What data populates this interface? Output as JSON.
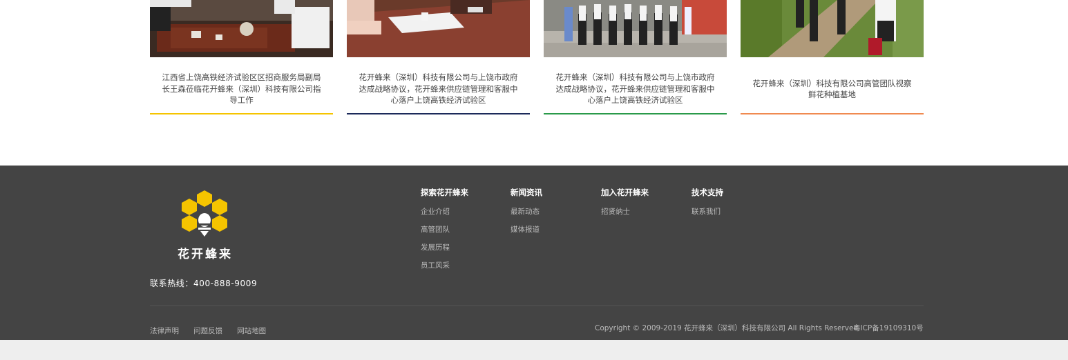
{
  "news": [
    {
      "title": "江西省上饶高铁经济试验区区招商服务局副局长王森莅临花开蜂来（深圳）科技有限公司指导工作",
      "accent": "#f5c400"
    },
    {
      "title": "花开蜂来（深圳）科技有限公司与上饶市政府达成战略协议，花开蜂来供应链管理和客服中心落户上饶高铁经济试验区",
      "accent": "#1c2a5a"
    },
    {
      "title": "花开蜂来（深圳）科技有限公司与上饶市政府达成战略协议，花开蜂来供应链管理和客服中心落户上饶高铁经济试验区",
      "accent": "#2a9a4a"
    },
    {
      "title": "花开蜂来（深圳）科技有限公司高管团队视察鲜花种植基地",
      "accent": "#f08a50"
    }
  ],
  "footer": {
    "logo_text": "花开蜂来",
    "hotline": "联系热线：400-888-9009",
    "columns": [
      {
        "heading": "探索花开蜂来",
        "links": [
          "企业介绍",
          "高管团队",
          "发展历程",
          "员工风采"
        ]
      },
      {
        "heading": "新闻资讯",
        "links": [
          "最新动态",
          "媒体报道"
        ]
      },
      {
        "heading": "加入花开蜂来",
        "links": [
          "招贤纳士"
        ]
      },
      {
        "heading": "技术支持",
        "links": [
          "联系我们"
        ]
      }
    ],
    "legal_links": [
      "法律声明",
      "问题反馈",
      "网站地图"
    ],
    "copyright": "Copyright © 2009-2019 花开蜂来（深圳）科技有限公司 All Rights Reserved.",
    "icp": "粤ICP备19109310号"
  },
  "colors": {
    "footer_bg": "#444444",
    "logo_yellow": "#f5c400"
  }
}
